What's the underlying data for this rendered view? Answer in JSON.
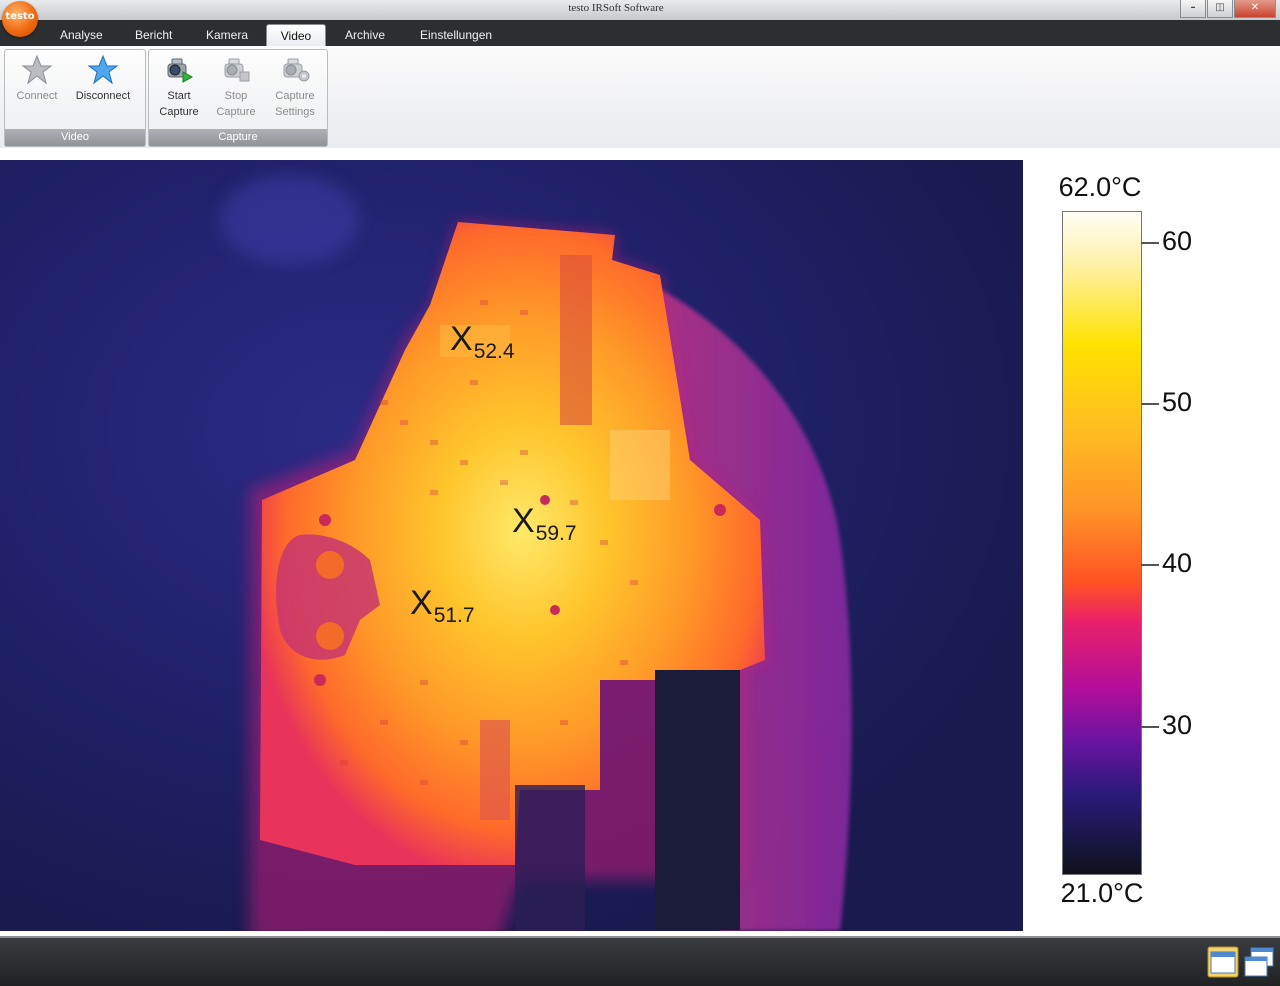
{
  "app": {
    "title": "testo IRSoft Software",
    "logo_text": "testo",
    "window_buttons": {
      "minimize": "–",
      "restore": "◫",
      "close": "✕"
    }
  },
  "tabs": [
    {
      "label": "Analyse",
      "active": false
    },
    {
      "label": "Bericht",
      "active": false
    },
    {
      "label": "Kamera",
      "active": false
    },
    {
      "label": "Video",
      "active": true
    },
    {
      "label": "Archive",
      "active": false
    },
    {
      "label": "Einstellungen",
      "active": false
    }
  ],
  "ribbon": {
    "video_group": {
      "label": "Video",
      "connect": {
        "label": "Connect",
        "enabled": false,
        "icon": "star-icon"
      },
      "disconnect": {
        "label": "Disconnect",
        "enabled": true,
        "icon": "star-blue-icon"
      }
    },
    "capture_group": {
      "label": "Capture",
      "start": {
        "label": "Start\nCapture",
        "enabled": true,
        "icon": "camera-play-icon"
      },
      "stop": {
        "label": "Stop\nCapture",
        "enabled": false,
        "icon": "camera-stop-icon"
      },
      "settings": {
        "label": "Capture\nSettings",
        "enabled": false,
        "icon": "camera-settings-icon"
      }
    }
  },
  "thermal_image": {
    "markers": [
      {
        "symbol": "X",
        "value": "52.4"
      },
      {
        "symbol": "X",
        "value": "59.7"
      },
      {
        "symbol": "X",
        "value": "51.7"
      }
    ]
  },
  "color_scale": {
    "max_label": "62.0°C",
    "min_label": "21.0°C",
    "ticks": [
      "60",
      "50",
      "40",
      "30"
    ],
    "palette": "iron"
  },
  "status_bar": {
    "icons": [
      "window-icon",
      "windows-cascade-icon"
    ]
  }
}
